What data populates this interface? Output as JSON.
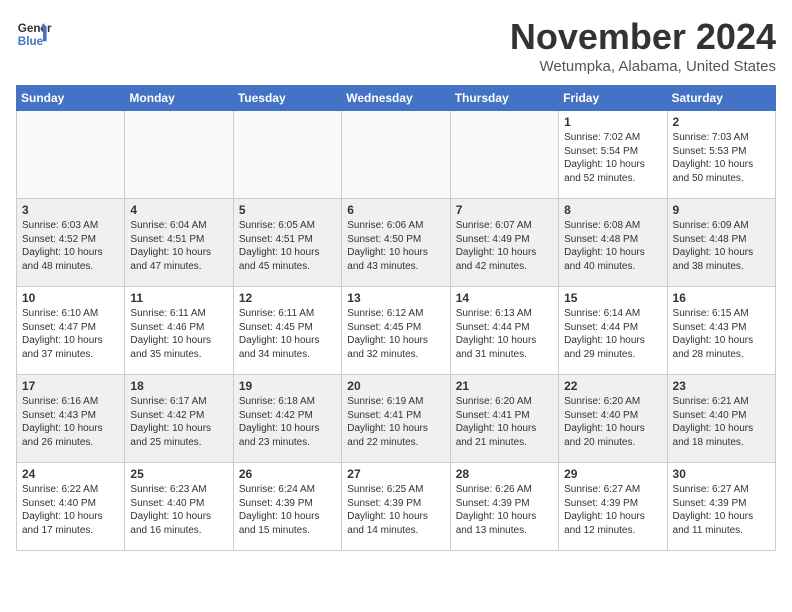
{
  "header": {
    "logo_line1": "General",
    "logo_line2": "Blue",
    "month": "November 2024",
    "location": "Wetumpka, Alabama, United States"
  },
  "weekdays": [
    "Sunday",
    "Monday",
    "Tuesday",
    "Wednesday",
    "Thursday",
    "Friday",
    "Saturday"
  ],
  "weeks": [
    [
      {
        "day": "",
        "info": ""
      },
      {
        "day": "",
        "info": ""
      },
      {
        "day": "",
        "info": ""
      },
      {
        "day": "",
        "info": ""
      },
      {
        "day": "",
        "info": ""
      },
      {
        "day": "1",
        "info": "Sunrise: 7:02 AM\nSunset: 5:54 PM\nDaylight: 10 hours\nand 52 minutes."
      },
      {
        "day": "2",
        "info": "Sunrise: 7:03 AM\nSunset: 5:53 PM\nDaylight: 10 hours\nand 50 minutes."
      }
    ],
    [
      {
        "day": "3",
        "info": "Sunrise: 6:03 AM\nSunset: 4:52 PM\nDaylight: 10 hours\nand 48 minutes."
      },
      {
        "day": "4",
        "info": "Sunrise: 6:04 AM\nSunset: 4:51 PM\nDaylight: 10 hours\nand 47 minutes."
      },
      {
        "day": "5",
        "info": "Sunrise: 6:05 AM\nSunset: 4:51 PM\nDaylight: 10 hours\nand 45 minutes."
      },
      {
        "day": "6",
        "info": "Sunrise: 6:06 AM\nSunset: 4:50 PM\nDaylight: 10 hours\nand 43 minutes."
      },
      {
        "day": "7",
        "info": "Sunrise: 6:07 AM\nSunset: 4:49 PM\nDaylight: 10 hours\nand 42 minutes."
      },
      {
        "day": "8",
        "info": "Sunrise: 6:08 AM\nSunset: 4:48 PM\nDaylight: 10 hours\nand 40 minutes."
      },
      {
        "day": "9",
        "info": "Sunrise: 6:09 AM\nSunset: 4:48 PM\nDaylight: 10 hours\nand 38 minutes."
      }
    ],
    [
      {
        "day": "10",
        "info": "Sunrise: 6:10 AM\nSunset: 4:47 PM\nDaylight: 10 hours\nand 37 minutes."
      },
      {
        "day": "11",
        "info": "Sunrise: 6:11 AM\nSunset: 4:46 PM\nDaylight: 10 hours\nand 35 minutes."
      },
      {
        "day": "12",
        "info": "Sunrise: 6:11 AM\nSunset: 4:45 PM\nDaylight: 10 hours\nand 34 minutes."
      },
      {
        "day": "13",
        "info": "Sunrise: 6:12 AM\nSunset: 4:45 PM\nDaylight: 10 hours\nand 32 minutes."
      },
      {
        "day": "14",
        "info": "Sunrise: 6:13 AM\nSunset: 4:44 PM\nDaylight: 10 hours\nand 31 minutes."
      },
      {
        "day": "15",
        "info": "Sunrise: 6:14 AM\nSunset: 4:44 PM\nDaylight: 10 hours\nand 29 minutes."
      },
      {
        "day": "16",
        "info": "Sunrise: 6:15 AM\nSunset: 4:43 PM\nDaylight: 10 hours\nand 28 minutes."
      }
    ],
    [
      {
        "day": "17",
        "info": "Sunrise: 6:16 AM\nSunset: 4:43 PM\nDaylight: 10 hours\nand 26 minutes."
      },
      {
        "day": "18",
        "info": "Sunrise: 6:17 AM\nSunset: 4:42 PM\nDaylight: 10 hours\nand 25 minutes."
      },
      {
        "day": "19",
        "info": "Sunrise: 6:18 AM\nSunset: 4:42 PM\nDaylight: 10 hours\nand 23 minutes."
      },
      {
        "day": "20",
        "info": "Sunrise: 6:19 AM\nSunset: 4:41 PM\nDaylight: 10 hours\nand 22 minutes."
      },
      {
        "day": "21",
        "info": "Sunrise: 6:20 AM\nSunset: 4:41 PM\nDaylight: 10 hours\nand 21 minutes."
      },
      {
        "day": "22",
        "info": "Sunrise: 6:20 AM\nSunset: 4:40 PM\nDaylight: 10 hours\nand 20 minutes."
      },
      {
        "day": "23",
        "info": "Sunrise: 6:21 AM\nSunset: 4:40 PM\nDaylight: 10 hours\nand 18 minutes."
      }
    ],
    [
      {
        "day": "24",
        "info": "Sunrise: 6:22 AM\nSunset: 4:40 PM\nDaylight: 10 hours\nand 17 minutes."
      },
      {
        "day": "25",
        "info": "Sunrise: 6:23 AM\nSunset: 4:40 PM\nDaylight: 10 hours\nand 16 minutes."
      },
      {
        "day": "26",
        "info": "Sunrise: 6:24 AM\nSunset: 4:39 PM\nDaylight: 10 hours\nand 15 minutes."
      },
      {
        "day": "27",
        "info": "Sunrise: 6:25 AM\nSunset: 4:39 PM\nDaylight: 10 hours\nand 14 minutes."
      },
      {
        "day": "28",
        "info": "Sunrise: 6:26 AM\nSunset: 4:39 PM\nDaylight: 10 hours\nand 13 minutes."
      },
      {
        "day": "29",
        "info": "Sunrise: 6:27 AM\nSunset: 4:39 PM\nDaylight: 10 hours\nand 12 minutes."
      },
      {
        "day": "30",
        "info": "Sunrise: 6:27 AM\nSunset: 4:39 PM\nDaylight: 10 hours\nand 11 minutes."
      }
    ]
  ]
}
